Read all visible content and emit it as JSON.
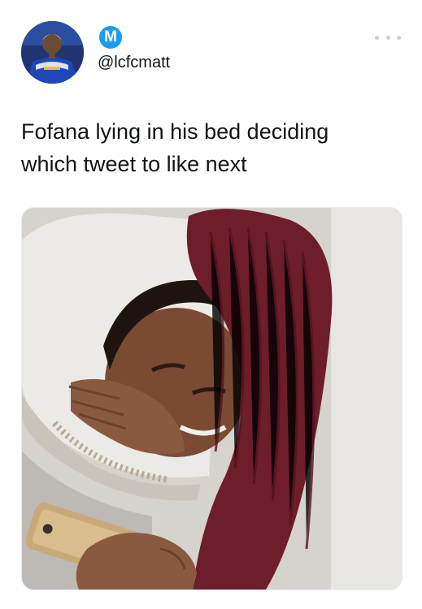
{
  "tweet": {
    "author": {
      "avatar_icon": "profile-photo-footballer",
      "verified_initial": "M",
      "handle": "@lcfcmatt"
    },
    "more_icon": "more-options-icon",
    "text": "Fofana lying in his bed deciding\nwhich tweet to like next",
    "media": {
      "description_icon": "photo-man-in-bed-with-phone"
    },
    "colors": {
      "accent": "#1d9bf0",
      "text": "#0f1419"
    }
  }
}
